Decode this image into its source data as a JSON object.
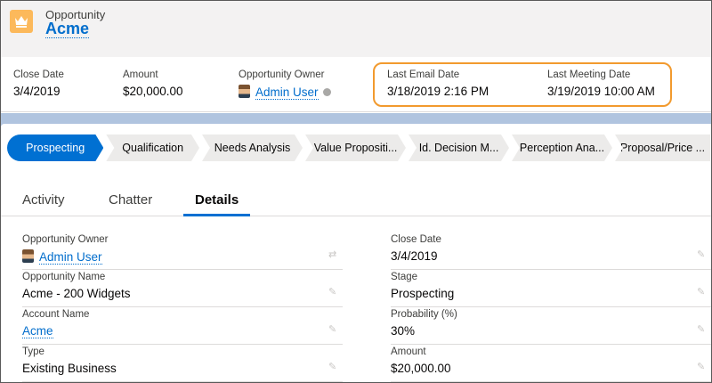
{
  "header": {
    "object_type": "Opportunity",
    "record_name": "Acme",
    "icon": "crown-icon"
  },
  "highlights": [
    {
      "label": "Close Date",
      "value": "3/4/2019"
    },
    {
      "label": "Amount",
      "value": "$20,000.00"
    },
    {
      "label": "Opportunity Owner",
      "value": "Admin User"
    },
    {
      "label": "Last Email Date",
      "value": "3/18/2019 2:16 PM"
    },
    {
      "label": "Last Meeting Date",
      "value": "3/19/2019 10:00 AM"
    }
  ],
  "path": {
    "stages": [
      "Prospecting",
      "Qualification",
      "Needs Analysis",
      "Value Propositi...",
      "Id. Decision M...",
      "Perception Ana...",
      "Proposal/Price ..."
    ],
    "active": "Prospecting"
  },
  "tabs": [
    "Activity",
    "Chatter",
    "Details"
  ],
  "active_tab": "Details",
  "details": {
    "left": [
      {
        "label": "Opportunity Owner",
        "value": "Admin User"
      },
      {
        "label": "Opportunity Name",
        "value": "Acme - 200 Widgets"
      },
      {
        "label": "Account Name",
        "value": "Acme"
      },
      {
        "label": "Type",
        "value": "Existing Business"
      }
    ],
    "right": [
      {
        "label": "Close Date",
        "value": "3/4/2019"
      },
      {
        "label": "Stage",
        "value": "Prospecting"
      },
      {
        "label": "Probability (%)",
        "value": "30%"
      },
      {
        "label": "Amount",
        "value": "$20,000.00"
      }
    ]
  },
  "colors": {
    "brand_blue": "#0070d2",
    "link_blue": "#006dcc",
    "highlight_orange": "#f29a2e",
    "icon_gold": "#fcb95b"
  }
}
